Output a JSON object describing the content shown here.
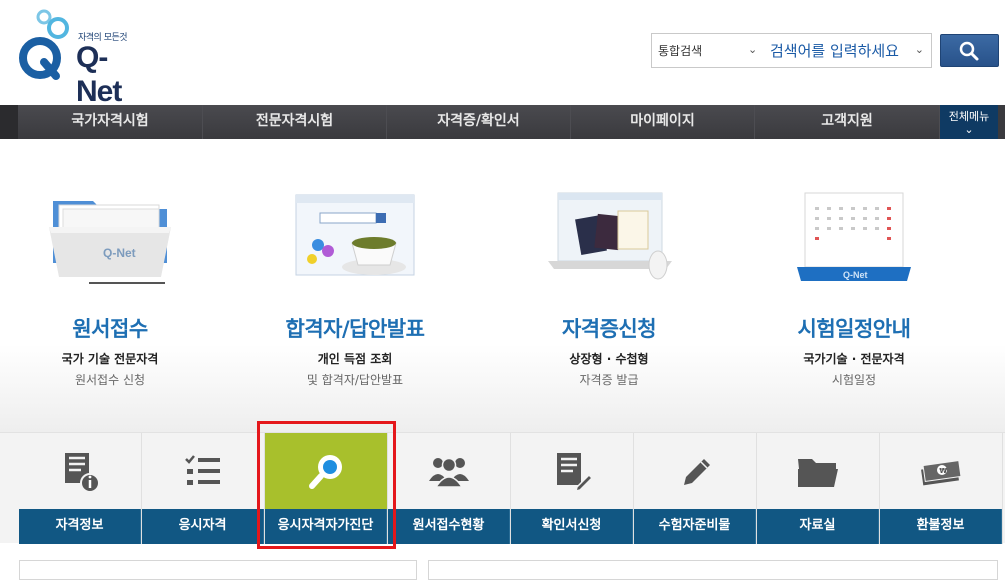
{
  "header": {
    "logo_tagline": "자격의 모든것",
    "logo_text": "Q-Net"
  },
  "search": {
    "category": "통합검색",
    "placeholder": "검색어를 입력하세요"
  },
  "gnb": {
    "items": [
      "국가자격시험",
      "전문자격시험",
      "자격증/확인서",
      "마이페이지",
      "고객지원"
    ],
    "all_menu": "전체메뉴"
  },
  "cards": [
    {
      "title": "원서접수",
      "sub": "국가 기술 전문자격",
      "desc": "원서접수 신청"
    },
    {
      "title": "합격자/답안발표",
      "sub": "개인 득점 조회",
      "desc": "및 합격자/답안발표"
    },
    {
      "title": "자격증신청",
      "sub": "상장형 · 수첩형",
      "desc": "자격증 발급"
    },
    {
      "title": "시험일정안내",
      "sub": "국가기술 · 전문자격",
      "desc": "시험일정"
    }
  ],
  "quick_menu": [
    {
      "label": "자격정보",
      "icon": "document-info-icon"
    },
    {
      "label": "응시자격",
      "icon": "checklist-icon"
    },
    {
      "label": "응시자격자가진단",
      "icon": "magnifier-icon"
    },
    {
      "label": "원서접수현황",
      "icon": "people-group-icon"
    },
    {
      "label": "확인서신청",
      "icon": "document-edit-icon"
    },
    {
      "label": "수험자준비물",
      "icon": "pencil-icon"
    },
    {
      "label": "자료실",
      "icon": "folder-icon"
    },
    {
      "label": "환불정보",
      "icon": "money-icon"
    }
  ],
  "colors": {
    "accent_blue": "#1e6fb3",
    "nav_dark": "#3a3a3e",
    "quick_label_bg": "#115783",
    "active_green": "#a8c02c",
    "highlight_red": "#e4171b"
  }
}
